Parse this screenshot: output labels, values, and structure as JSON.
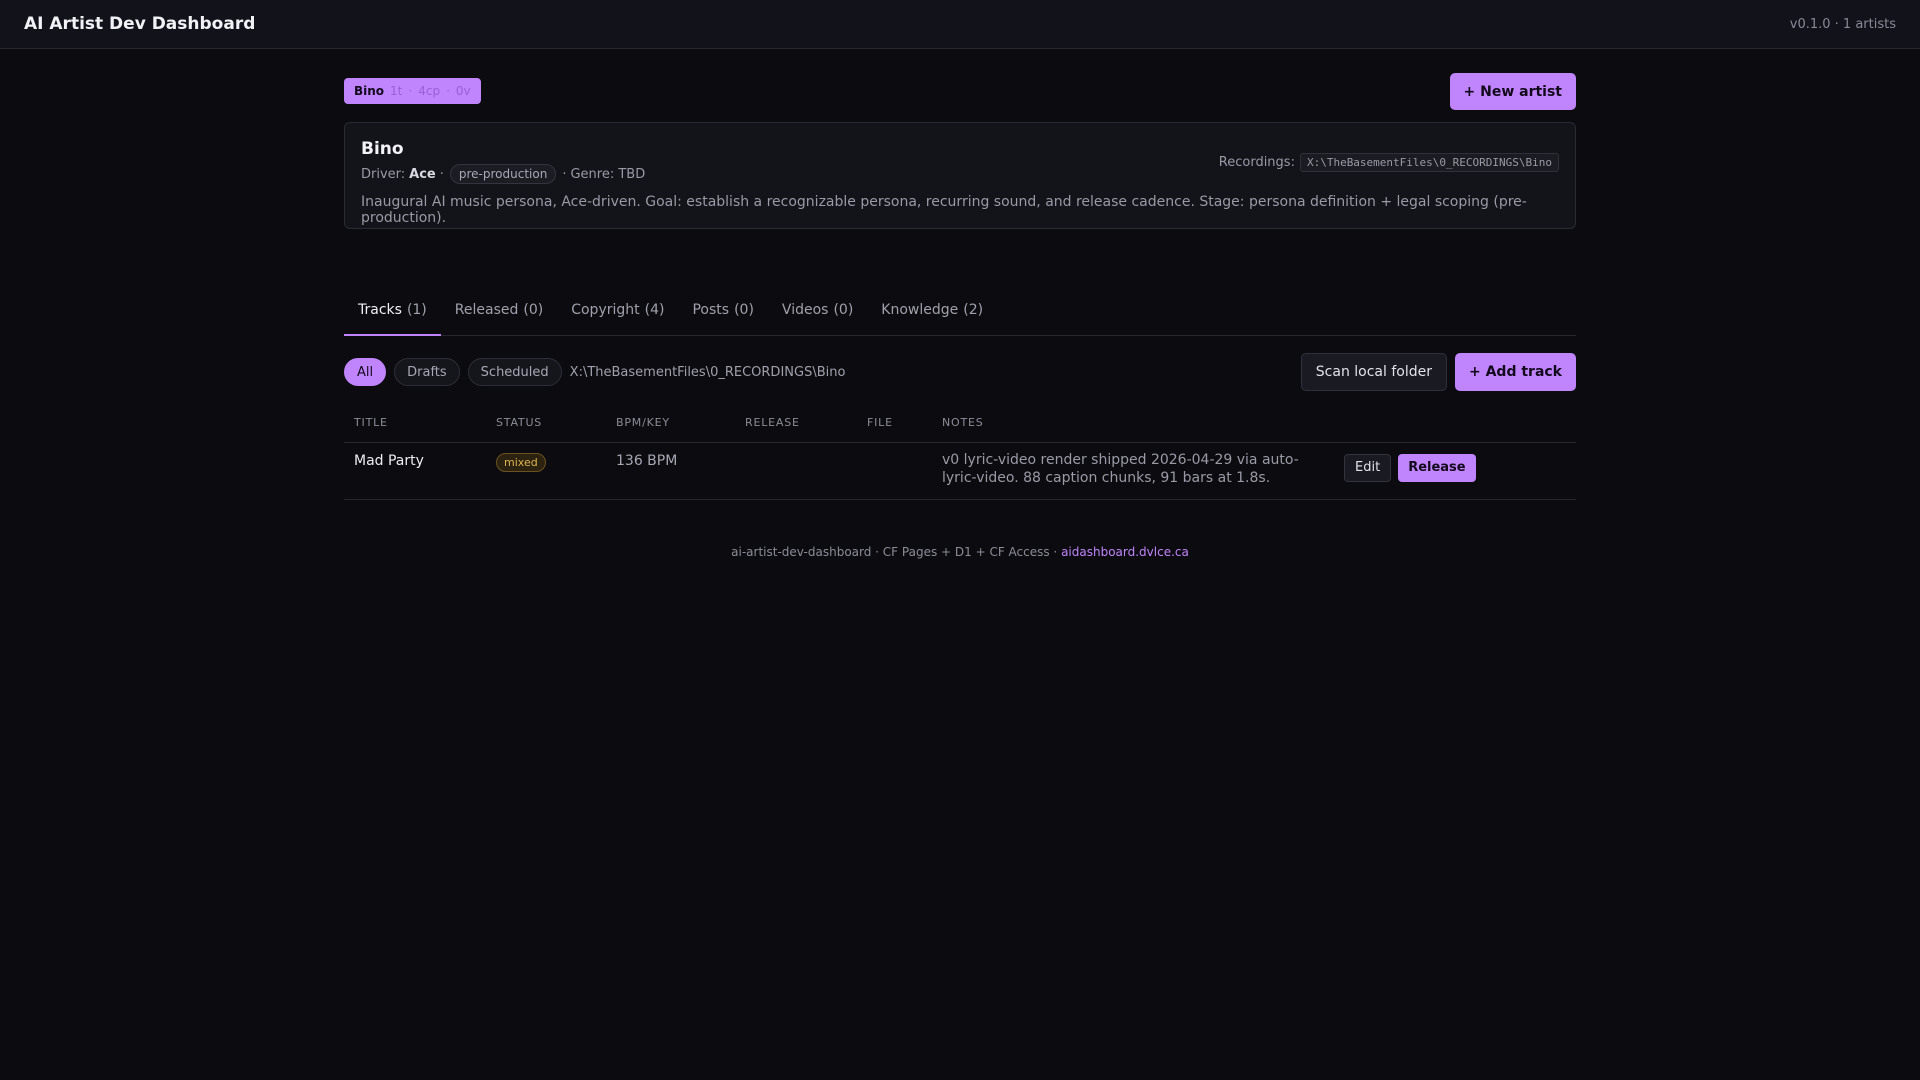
{
  "header": {
    "title": "AI Artist Dev Dashboard",
    "version": "v0.1.0 · 1 artists"
  },
  "artist_chip": {
    "name": "Bino",
    "tracks": "1t",
    "copyright": "4cp",
    "videos": "0v",
    "separator": "·"
  },
  "new_artist_label": "+ New artist",
  "artist": {
    "name": "Bino",
    "driver_label": "Driver:",
    "driver": "Ace",
    "separator": "·",
    "stage": "pre-production",
    "genre": "Genre: TBD",
    "description": "Inaugural AI music persona, Ace-driven. Goal: establish a recognizable persona, recurring sound, and release cadence. Stage: persona definition + legal scoping (pre-production).",
    "recordings_label": "Recordings:",
    "recordings_path": "X:\\TheBasementFiles\\0_RECORDINGS\\Bino"
  },
  "tabs": [
    {
      "label": "Tracks",
      "count": "(1)"
    },
    {
      "label": "Released",
      "count": "(0)"
    },
    {
      "label": "Copyright",
      "count": "(4)"
    },
    {
      "label": "Posts",
      "count": "(0)"
    },
    {
      "label": "Videos",
      "count": "(0)"
    },
    {
      "label": "Knowledge",
      "count": "(2)"
    }
  ],
  "filters": {
    "all": "All",
    "drafts": "Drafts",
    "scheduled": "Scheduled",
    "path": "X:\\TheBasementFiles\\0_RECORDINGS\\Bino",
    "scan_label": "Scan local folder",
    "add_track_label": "+ Add track"
  },
  "table": {
    "columns": [
      "TITLE",
      "STATUS",
      "BPM/KEY",
      "RELEASE",
      "FILE",
      "NOTES"
    ],
    "rows": [
      {
        "title": "Mad Party",
        "status": "mixed",
        "bpm": "136 BPM",
        "release": "",
        "file": "",
        "notes": "v0 lyric-video render shipped 2026-04-29 via auto-lyric-video. 88 caption chunks, 91 bars at 1.8s.",
        "edit_label": "Edit",
        "release_label": "Release"
      }
    ]
  },
  "footer": {
    "text": "ai-artist-dev-dashboard · CF Pages + D1 + CF Access ·",
    "link": "aidashboard.dvlce.ca"
  },
  "colors": {
    "accent": "#c084fc",
    "background": "#0c0c10",
    "status_mixed": "#e0b44c"
  }
}
